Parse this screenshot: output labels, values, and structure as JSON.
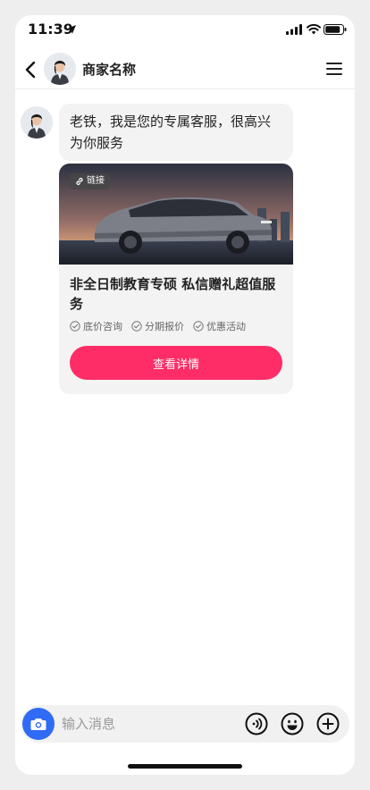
{
  "status_bar": {
    "time": "11:39",
    "icons": [
      "location-arrow-icon",
      "signal-icon",
      "wifi-icon",
      "battery-icon"
    ]
  },
  "nav": {
    "title": "商家名称",
    "icons": [
      "back-arrow-icon",
      "avatar",
      "menu-icon"
    ]
  },
  "chat": {
    "greeting": "老铁，我是您的专属客服，很高兴为你服务",
    "card": {
      "badge": "链接",
      "title": "非全日制教育专硕 私信赠礼超值服务",
      "tags": [
        "底价咨询",
        "分期报价",
        "优惠活动"
      ],
      "cta": "查看详情"
    }
  },
  "input_bar": {
    "placeholder": "输入消息",
    "value": "",
    "icons": [
      "camera-icon",
      "voice-icon",
      "emoji-icon",
      "plus-icon"
    ]
  },
  "colors": {
    "accent": "#ff2d67",
    "camera": "#2f6bf5",
    "bubble": "#f3f3f3"
  }
}
